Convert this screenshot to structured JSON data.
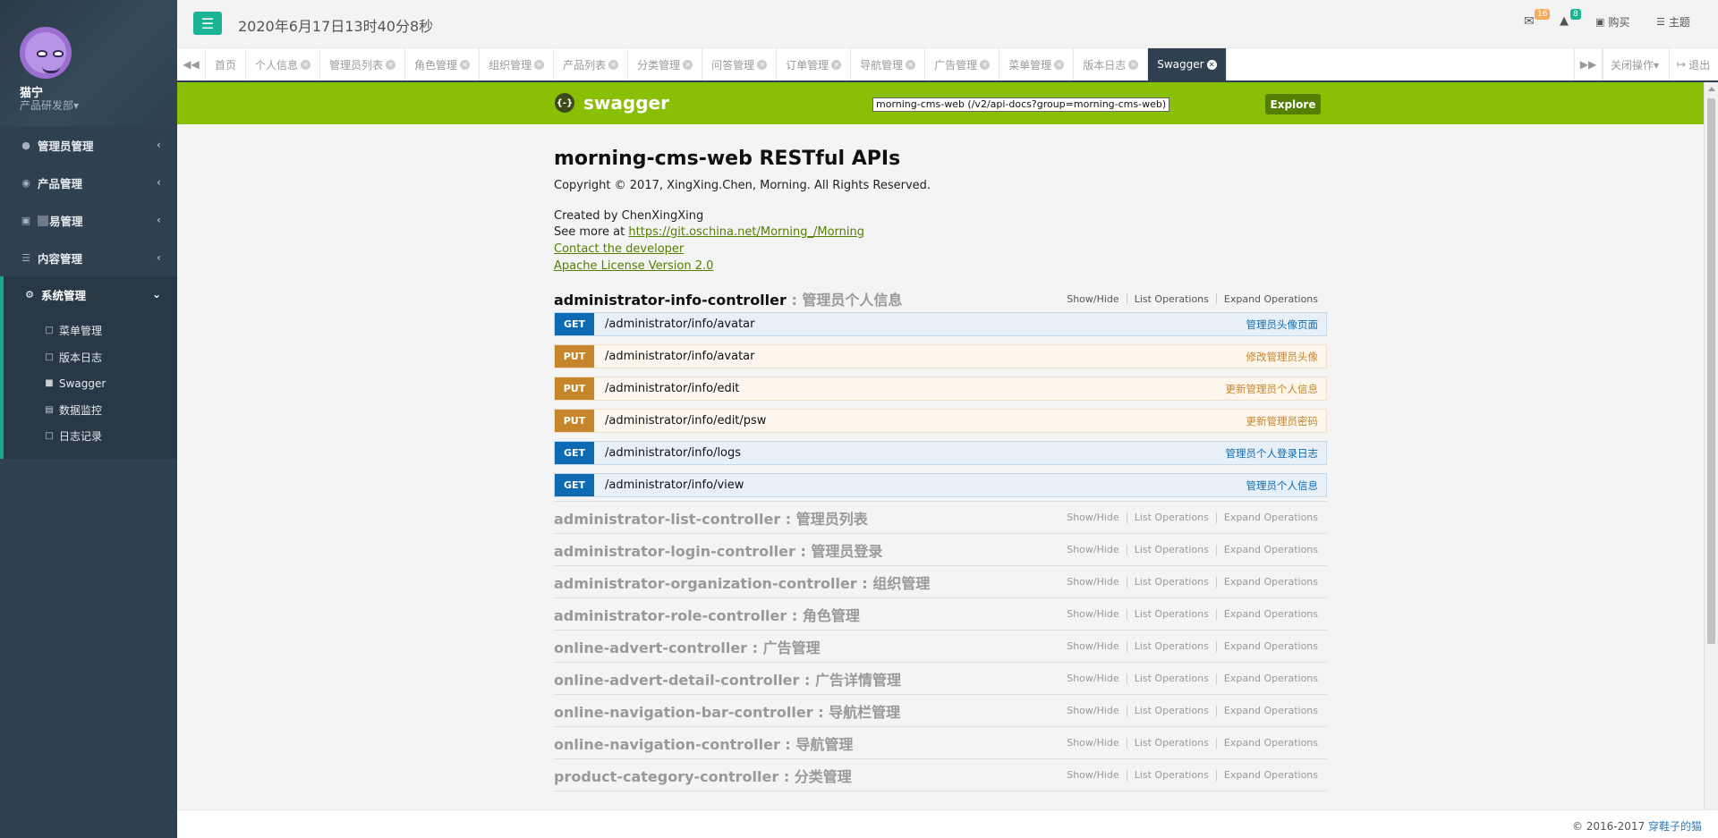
{
  "user": {
    "name": "猫宁",
    "dept": "产品研发部▾"
  },
  "sidebar": {
    "items": [
      {
        "label": "管理员管理"
      },
      {
        "label": "产品管理"
      },
      {
        "label": "易管理"
      },
      {
        "label": "内容管理"
      },
      {
        "label": "系统管理"
      }
    ],
    "sub_items": [
      {
        "label": "菜单管理"
      },
      {
        "label": "版本日志"
      },
      {
        "label": "Swagger"
      },
      {
        "label": "数据监控"
      },
      {
        "label": "日志记录"
      }
    ]
  },
  "header": {
    "datetime": "2020年6月17日13时40分8秒",
    "mail_count": "16",
    "notify_count": "8",
    "buy_label": "购买",
    "theme_label": "主题"
  },
  "tabs": {
    "items": [
      {
        "label": "首页"
      },
      {
        "label": "个人信息"
      },
      {
        "label": "管理员列表"
      },
      {
        "label": "角色管理"
      },
      {
        "label": "组织管理"
      },
      {
        "label": "产品列表"
      },
      {
        "label": "分类管理"
      },
      {
        "label": "问答管理"
      },
      {
        "label": "订单管理"
      },
      {
        "label": "导航管理"
      },
      {
        "label": "广告管理"
      },
      {
        "label": "菜单管理"
      },
      {
        "label": "版本日志"
      },
      {
        "label": "Swagger"
      }
    ],
    "close_ops": "关闭操作▾",
    "logout": "退出"
  },
  "swagger": {
    "logo_text": "swagger",
    "logo_glyph": "{-}",
    "api_select": "morning-cms-web (/v2/api-docs?group=morning-cms-web) ▼",
    "explore": "Explore",
    "title": "morning-cms-web RESTful APIs",
    "copyright": "Copyright © 2017, XingXing.Chen, Morning. All Rights Reserved.",
    "created_by": "Created by ChenXingXing",
    "see_more_prefix": "See more at ",
    "see_more_link": "https://git.oschina.net/Morning_/Morning",
    "contact": "Contact the developer",
    "license": "Apache License Version 2.0",
    "show_hide": "Show/Hide",
    "list_ops": "List Operations",
    "expand_ops": "Expand Operations",
    "open_controller": {
      "name": "administrator-info-controller",
      "desc": " : 管理员个人信息",
      "operations": [
        {
          "method": "GET",
          "path": "/administrator/info/avatar",
          "summary": "管理员头像页面"
        },
        {
          "method": "PUT",
          "path": "/administrator/info/avatar",
          "summary": "修改管理员头像"
        },
        {
          "method": "PUT",
          "path": "/administrator/info/edit",
          "summary": "更新管理员个人信息"
        },
        {
          "method": "PUT",
          "path": "/administrator/info/edit/psw",
          "summary": "更新管理员密码"
        },
        {
          "method": "GET",
          "path": "/administrator/info/logs",
          "summary": "管理员个人登录日志"
        },
        {
          "method": "GET",
          "path": "/administrator/info/view",
          "summary": "管理员个人信息"
        }
      ]
    },
    "controllers": [
      {
        "name": "administrator-list-controller",
        "desc": " : 管理员列表"
      },
      {
        "name": "administrator-login-controller",
        "desc": " : 管理员登录"
      },
      {
        "name": "administrator-organization-controller",
        "desc": " : 组织管理"
      },
      {
        "name": "administrator-role-controller",
        "desc": " : 角色管理"
      },
      {
        "name": "online-advert-controller",
        "desc": " : 广告管理"
      },
      {
        "name": "online-advert-detail-controller",
        "desc": " : 广告详情管理"
      },
      {
        "name": "online-navigation-bar-controller",
        "desc": " : 导航栏管理"
      },
      {
        "name": "online-navigation-controller",
        "desc": " : 导航管理"
      },
      {
        "name": "product-category-controller",
        "desc": " : 分类管理"
      }
    ]
  },
  "footer": {
    "copyright": "© 2016-2017 ",
    "brand": "穿鞋子的猫"
  },
  "colors": {
    "sidebar": "#2f4050",
    "accent": "#1ab394",
    "swagger_green": "#89bf04",
    "get": "#0f6ab4",
    "put": "#c5862b"
  }
}
